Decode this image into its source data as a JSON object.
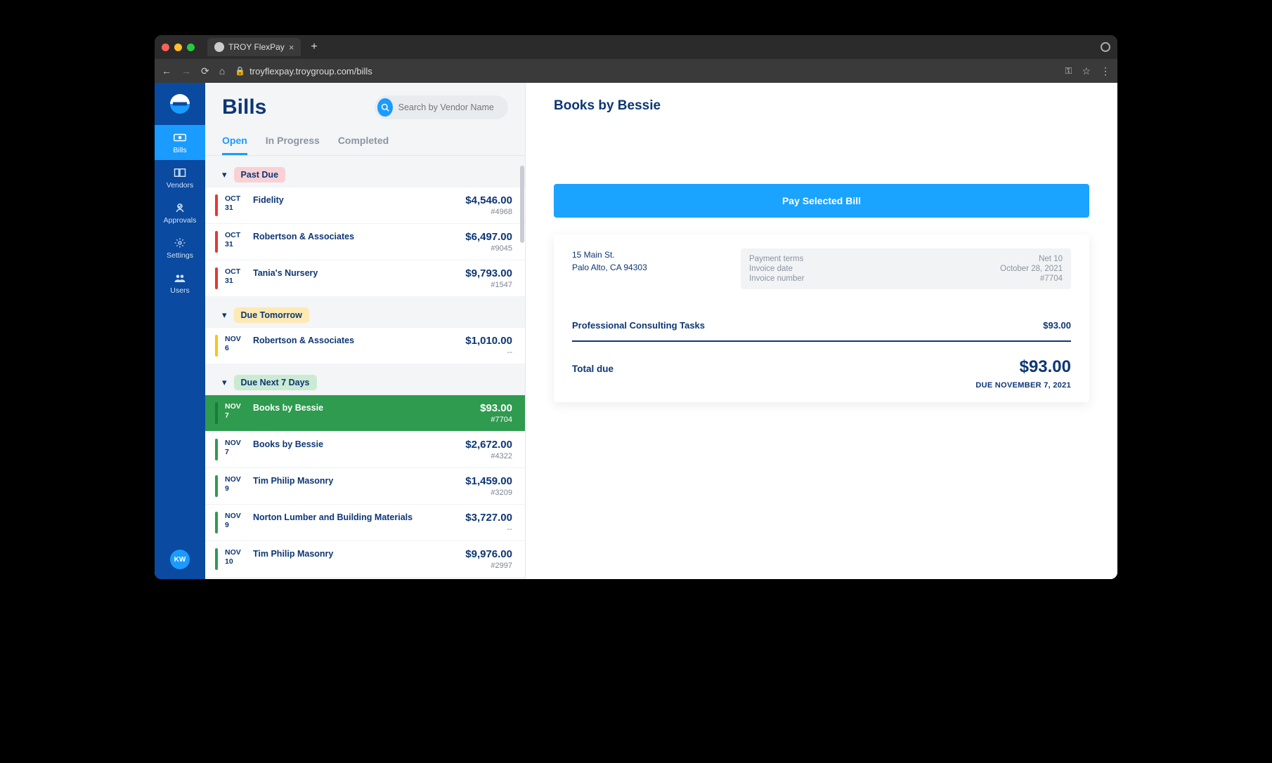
{
  "browser": {
    "tab_title": "TROY FlexPay",
    "url": "troyflexpay.troygroup.com/bills"
  },
  "sidebar": {
    "items": [
      {
        "label": "Bills"
      },
      {
        "label": "Vendors"
      },
      {
        "label": "Approvals"
      },
      {
        "label": "Settings"
      },
      {
        "label": "Users"
      }
    ],
    "avatar_initials": "KW"
  },
  "page": {
    "title": "Bills",
    "search_placeholder": "Search by Vendor Name",
    "tabs": [
      {
        "label": "Open",
        "active": true
      },
      {
        "label": "In Progress"
      },
      {
        "label": "Completed"
      }
    ]
  },
  "groups": [
    {
      "name": "Past Due",
      "color": "red",
      "bills": [
        {
          "month": "OCT",
          "day": "31",
          "vendor": "Fidelity",
          "amount": "$4,546.00",
          "number": "#4968"
        },
        {
          "month": "OCT",
          "day": "31",
          "vendor": "Robertson & Associates",
          "amount": "$6,497.00",
          "number": "#9045"
        },
        {
          "month": "OCT",
          "day": "31",
          "vendor": "Tania's Nursery",
          "amount": "$9,793.00",
          "number": "#1547"
        }
      ]
    },
    {
      "name": "Due Tomorrow",
      "color": "yellow",
      "bills": [
        {
          "month": "NOV",
          "day": "6",
          "vendor": "Robertson & Associates",
          "amount": "$1,010.00",
          "number": "--"
        }
      ]
    },
    {
      "name": "Due Next 7 Days",
      "color": "green",
      "bills": [
        {
          "month": "NOV",
          "day": "7",
          "vendor": "Books by Bessie",
          "amount": "$93.00",
          "number": "#7704",
          "selected": true
        },
        {
          "month": "NOV",
          "day": "7",
          "vendor": "Books by Bessie",
          "amount": "$2,672.00",
          "number": "#4322"
        },
        {
          "month": "NOV",
          "day": "9",
          "vendor": "Tim Philip Masonry",
          "amount": "$1,459.00",
          "number": "#3209"
        },
        {
          "month": "NOV",
          "day": "9",
          "vendor": "Norton Lumber and Building Materials",
          "amount": "$3,727.00",
          "number": "--"
        },
        {
          "month": "NOV",
          "day": "10",
          "vendor": "Tim Philip Masonry",
          "amount": "$9,976.00",
          "number": "#2997"
        }
      ]
    }
  ],
  "detail": {
    "vendor": "Books by Bessie",
    "pay_button": "Pay Selected Bill",
    "address_line1": "15 Main St.",
    "address_line2": "Palo Alto, CA 94303",
    "terms": {
      "payment_terms_label": "Payment terms",
      "payment_terms_value": "Net 10",
      "invoice_date_label": "Invoice date",
      "invoice_date_value": "October 28, 2021",
      "invoice_number_label": "Invoice number",
      "invoice_number_value": "#7704"
    },
    "line_item_label": "Professional Consulting Tasks",
    "line_item_amount": "$93.00",
    "total_label": "Total due",
    "total_amount": "$93.00",
    "due_text": "DUE NOVEMBER 7, 2021"
  }
}
